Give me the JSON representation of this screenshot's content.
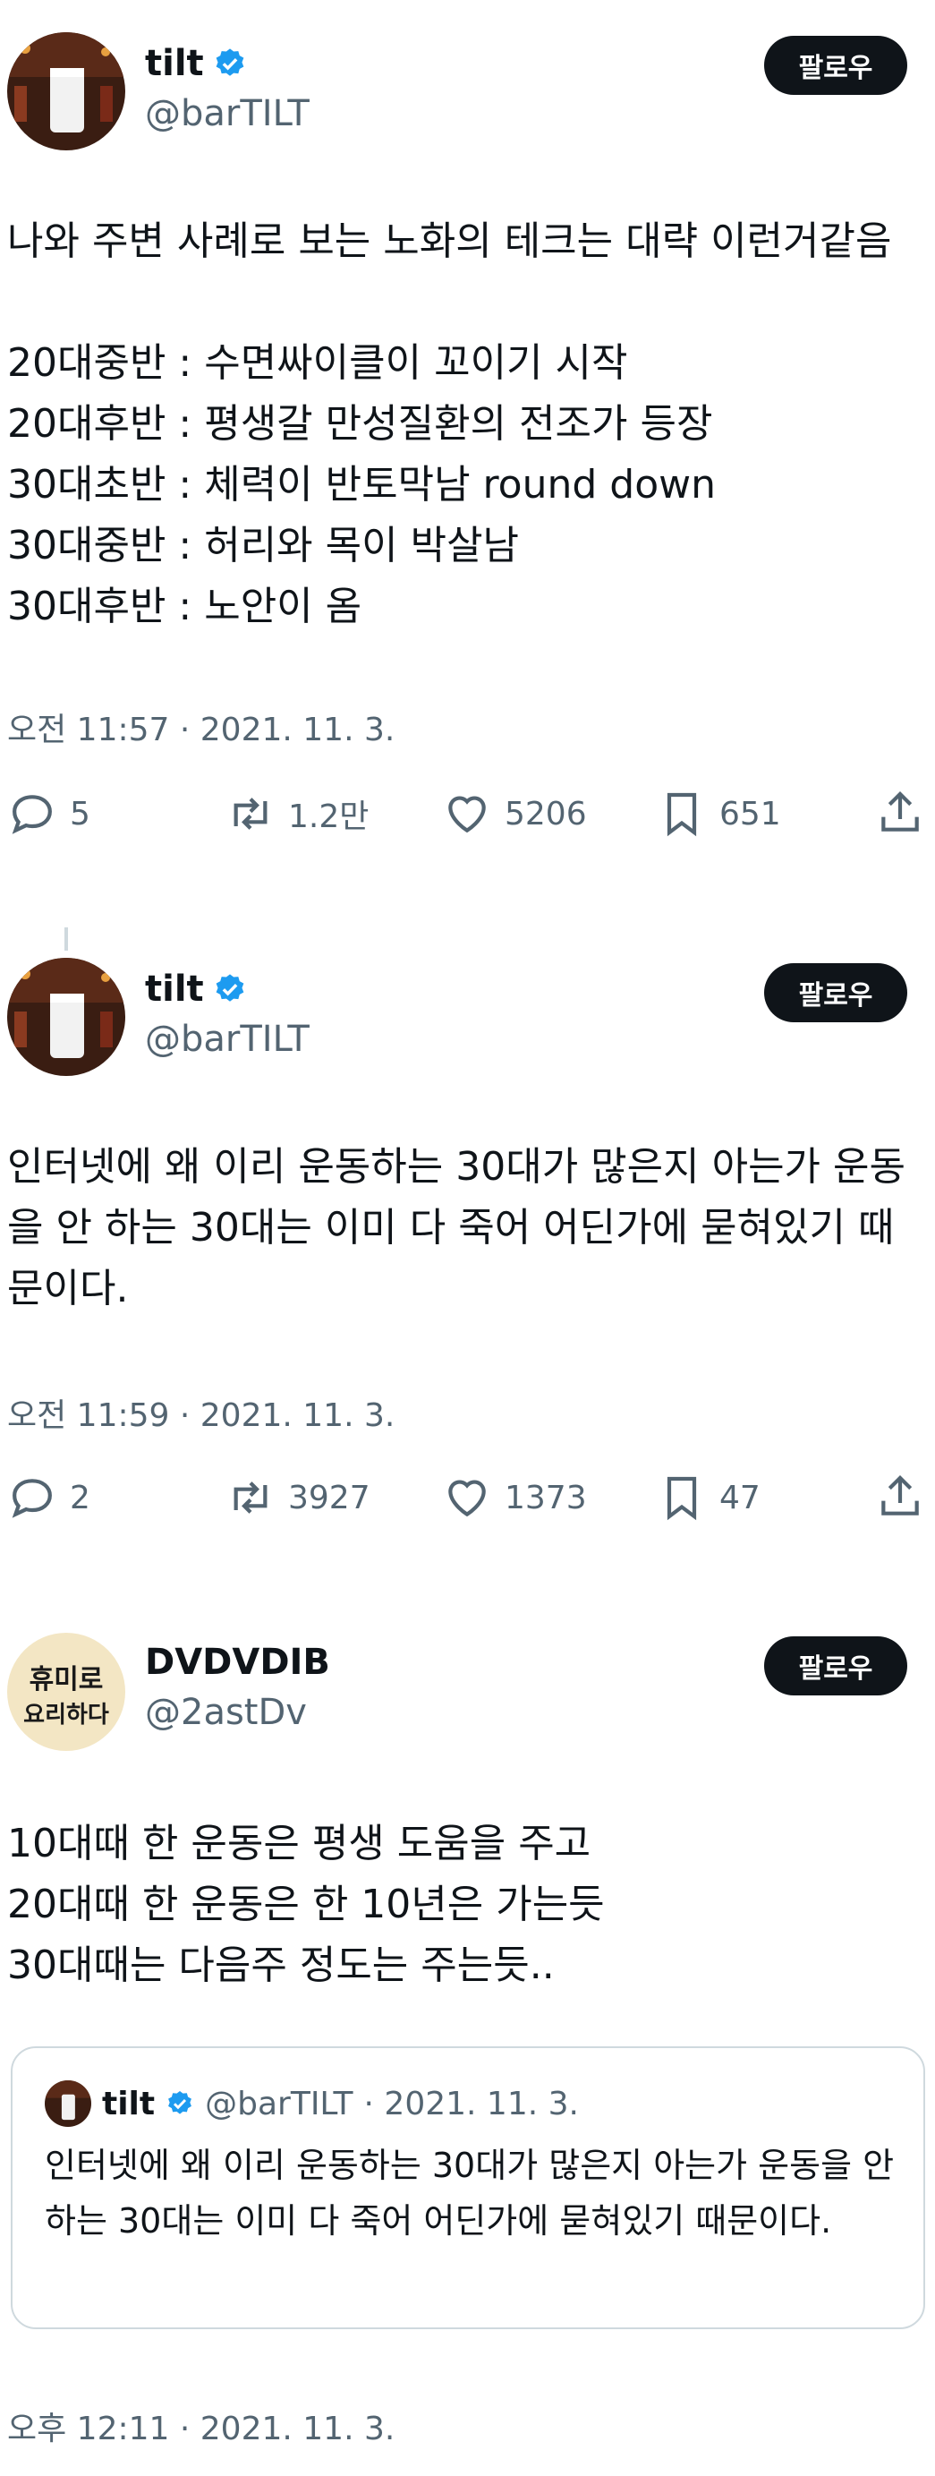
{
  "follow_label": "팔로우",
  "tweets": [
    {
      "name": "tilt",
      "handle": "@barTILT",
      "text": "나와 주변 사례로 보는 노화의 테크는 대략 이런거같음\n\n20대중반 : 수면싸이클이 꼬이기 시작\n20대후반 : 평생갈 만성질환의 전조가 등장\n30대초반 : 체력이 반토막남 round down\n30대중반 : 허리와 목이 박살남\n30대후반 : 노안이 옴",
      "timestamp": "오전 11:57 · 2021. 11. 3.",
      "replies": "5",
      "retweets": "1.2만",
      "likes": "5206",
      "bookmarks": "651"
    },
    {
      "name": "tilt",
      "handle": "@barTILT",
      "text": "인터넷에 왜 이리 운동하는 30대가 많은지 아는가 운동을 안 하는 30대는 이미 다 죽어 어딘가에 묻혀있기 때문이다.",
      "timestamp": "오전 11:59 · 2021. 11. 3.",
      "replies": "2",
      "retweets": "3927",
      "likes": "1373",
      "bookmarks": "47"
    },
    {
      "name": "DVDVDIB",
      "handle": "@2astDv",
      "avatar_text": "휴미로 요리하다",
      "text": "10대때 한 운동은 평생 도움을 주고\n20대때 한 운동은 한 10년은 가는듯\n30대때는 다음주 정도는 주는듯..",
      "timestamp": "오후 12:11 · 2021. 11. 3."
    }
  ],
  "quote": {
    "name": "tilt",
    "handle": "@barTILT",
    "date": "· 2021. 11. 3.",
    "text": "인터넷에 왜 이리 운동하는 30대가 많은지 아는가 운동을 안 하는 30대는 이미 다 죽어 어딘가에 묻혀있기 때문이다."
  },
  "colors": {
    "text": "#0f1419",
    "secondary": "#536471",
    "verified": "#1d9bf0",
    "follow_bg": "#0f1419",
    "border": "#cfd9de"
  }
}
